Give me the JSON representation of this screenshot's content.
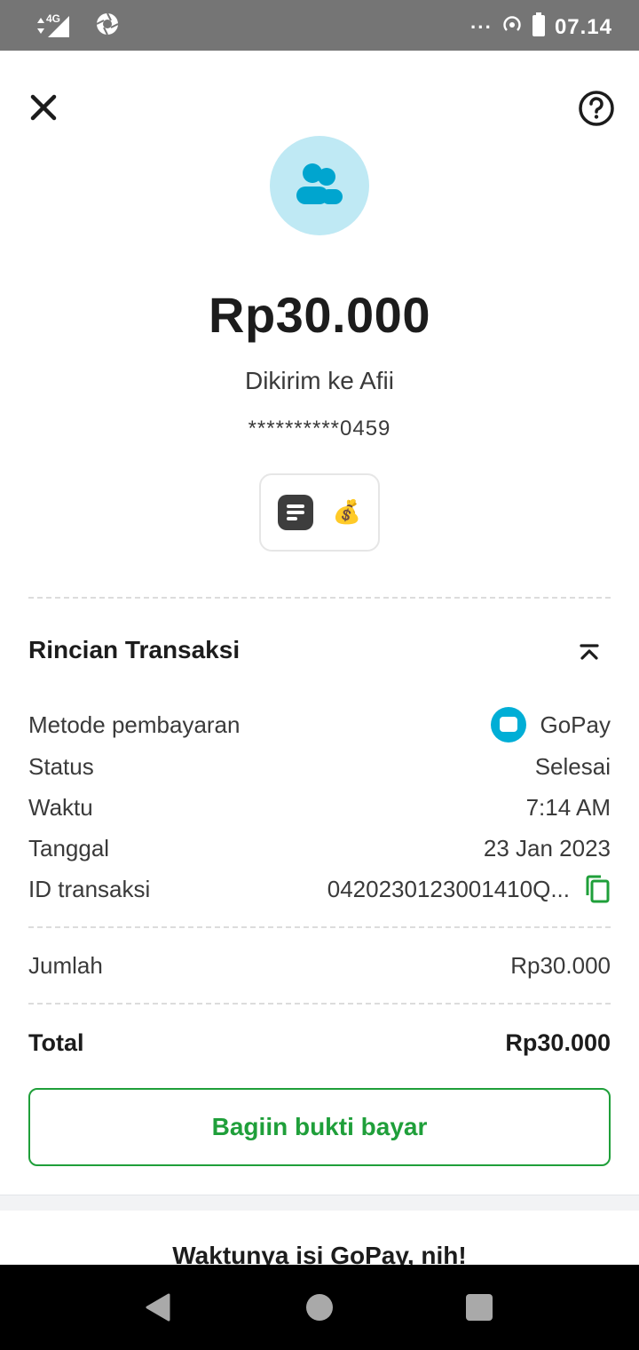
{
  "status_bar": {
    "network": "4G",
    "overflow": "···",
    "time": "07.14",
    "icons": [
      "signal-icon",
      "aperture-icon",
      "hotspot-icon",
      "battery-icon"
    ]
  },
  "header": {
    "close_icon": "close-icon",
    "help_icon": "help-icon"
  },
  "transaction": {
    "amount": "Rp30.000",
    "recipient": "Dikirim ke Afii",
    "account": "**********0459",
    "note_icon": "note-icon",
    "emoji": "💰"
  },
  "details": {
    "title": "Rincian Transaksi",
    "rows": [
      {
        "label": "Metode pembayaran",
        "value": "GoPay"
      },
      {
        "label": "Status",
        "value": "Selesai"
      },
      {
        "label": "Waktu",
        "value": "7:14 AM"
      },
      {
        "label": "Tanggal",
        "value": "23 Jan 2023"
      },
      {
        "label": "ID transaksi",
        "value": "0420230123001410Q..."
      }
    ],
    "amount_label": "Jumlah",
    "amount_value": "Rp30.000",
    "total_label": "Total",
    "total_value": "Rp30.000"
  },
  "share_button": "Bagiin bukti bayar",
  "promo_title": "Waktunya isi GoPay, nih!",
  "colors": {
    "accent_green": "#1f9f3a",
    "gopay_blue": "#00aed6",
    "avatar_bg": "#bfe9f4",
    "avatar_icon": "#00a5cf"
  }
}
